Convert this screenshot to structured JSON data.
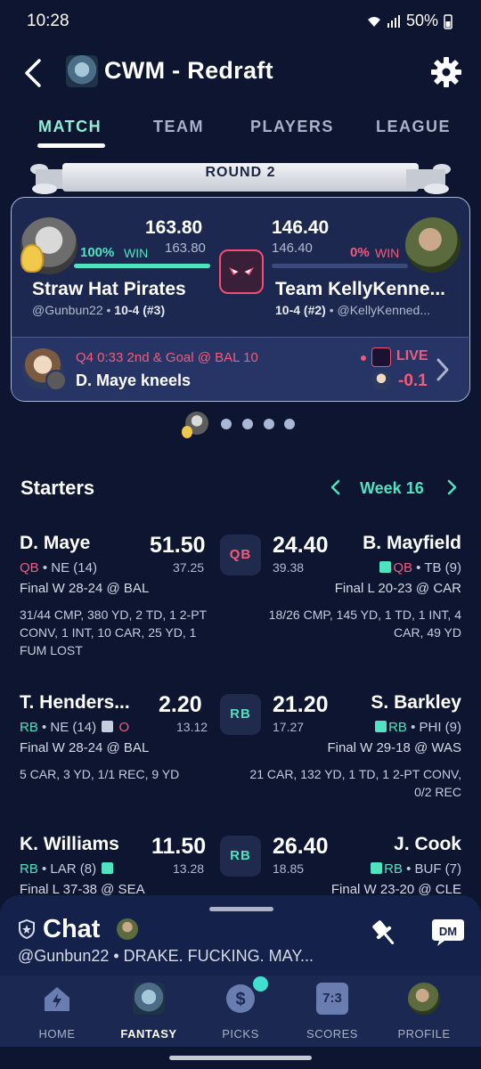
{
  "status_bar": {
    "time": "10:28",
    "battery": "50%"
  },
  "header": {
    "title": "CWM - Redraft"
  },
  "tabs": [
    {
      "label": "MATCH"
    },
    {
      "label": "TEAM"
    },
    {
      "label": "PLAYERS"
    },
    {
      "label": "LEAGUE"
    }
  ],
  "round": {
    "label": "ROUND 2"
  },
  "matchup": {
    "team1": {
      "score": "163.80",
      "projected": "163.80",
      "win_pct": "100%",
      "win_label": "WIN",
      "name": "Straw Hat Pirates",
      "handle": "@Gunbun22",
      "record": "10-4 (#3)",
      "progress": 1.0
    },
    "team2": {
      "score": "146.40",
      "projected": "146.40",
      "win_pct": "0%",
      "win_label": "WIN",
      "name": "Team KellyKenne...",
      "handle": "@KellyKenned...",
      "record": "10-4 (#2)",
      "progress": 0.0
    },
    "separator": "•",
    "live": {
      "situation": "Q4 0:33 2nd & Goal @ BAL 10",
      "play": "D. Maye kneels",
      "label": "LIVE",
      "delta": "-0.1"
    }
  },
  "starters": {
    "title": "Starters",
    "week_label": "Week 16",
    "rows": [
      {
        "slot": "QB",
        "left": {
          "name": "D. Maye",
          "points": "51.50",
          "projected": "37.25",
          "pos": "QB",
          "team_info": " • NE (14)",
          "game": "Final W 28-24 @ BAL",
          "stats": "31/44 CMP, 380 YD, 2 TD, 1 2-PT CONV, 1 INT, 10 CAR, 25 YD, 1 FUM LOST"
        },
        "right": {
          "name": "B. Mayfield",
          "points": "24.40",
          "projected": "39.38",
          "pos": "QB",
          "team_info": " • TB (9)",
          "game": "Final L 20-23 @ CAR",
          "stats": "18/26 CMP, 145 YD, 1 TD, 1 INT, 4 CAR, 49 YD"
        }
      },
      {
        "slot": "RB",
        "left": {
          "name": "T. Henders...",
          "points": "2.20",
          "projected": "13.12",
          "pos": "RB",
          "team_info": " • NE (14) ",
          "status": "O",
          "game": "Final W 28-24 @ BAL",
          "stats": "5 CAR, 3 YD, 1/1 REC, 9 YD"
        },
        "right": {
          "name": "S. Barkley",
          "points": "21.20",
          "projected": "17.27",
          "pos": "RB",
          "team_info": " • PHI (9)",
          "game": "Final W 29-18 @ WAS",
          "stats": "21 CAR, 132 YD, 1 TD, 1 2-PT CONV, 0/2 REC"
        }
      },
      {
        "slot": "RB",
        "left": {
          "name": "K. Williams",
          "points": "11.50",
          "projected": "13.28",
          "pos": "RB",
          "team_info": " • LAR (8) ",
          "game": "Final L 37-38 @ SEA"
        },
        "right": {
          "name": "J. Cook",
          "points": "26.40",
          "projected": "18.85",
          "pos": "RB",
          "team_info": " • BUF (7)",
          "game": "Final W 23-20 @ CLE"
        }
      }
    ]
  },
  "chat": {
    "title": "Chat",
    "preview": "@Gunbun22 • DRAKE. FUCKING. MAY...",
    "dm_label": "DM"
  },
  "bottom_nav": [
    {
      "label": "HOME"
    },
    {
      "label": "FANTASY"
    },
    {
      "label": "PICKS"
    },
    {
      "label": "SCORES",
      "icon_text": "7:3"
    },
    {
      "label": "PROFILE"
    }
  ],
  "colors": {
    "background": "#0d1530",
    "accent_green": "#4fe3c0",
    "accent_red": "#f25c7a",
    "card": "#1c2850"
  }
}
